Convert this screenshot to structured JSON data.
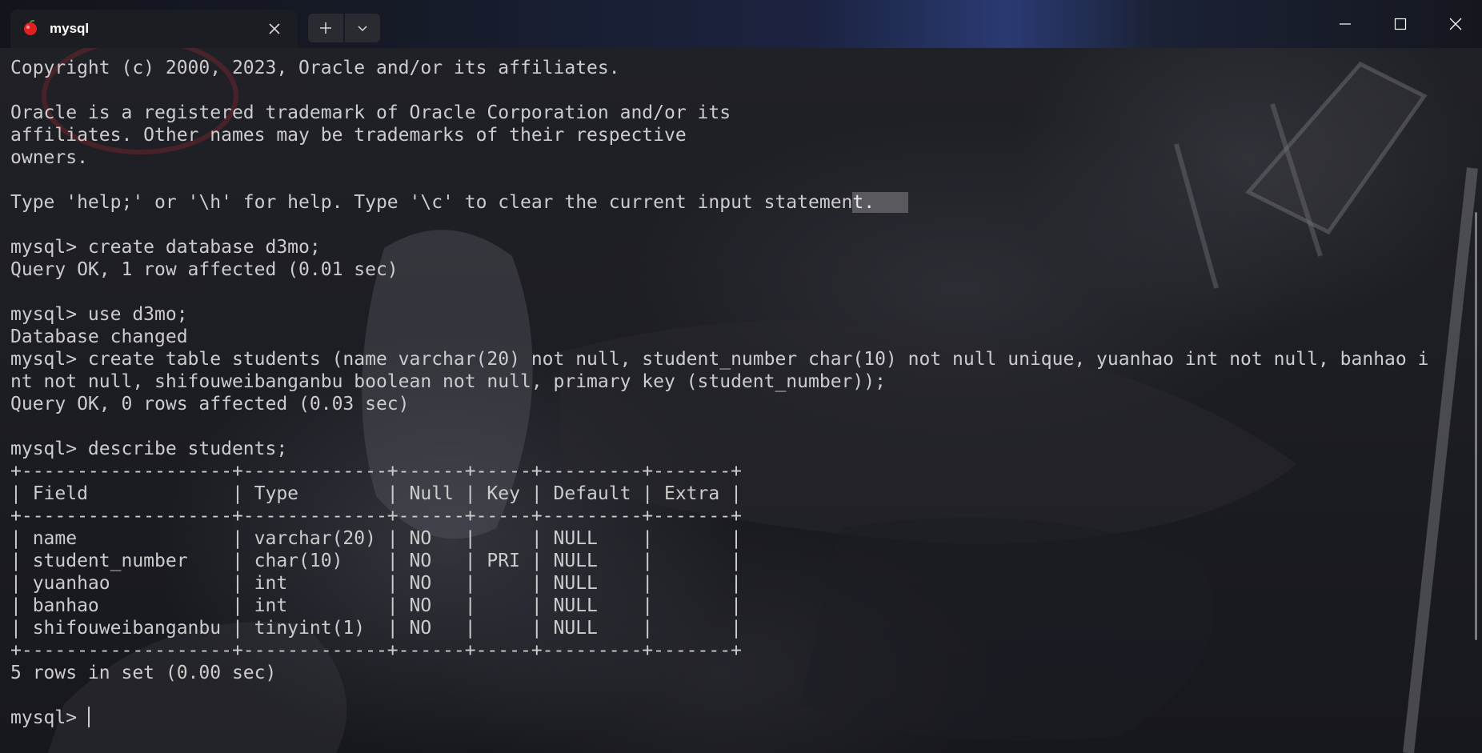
{
  "window": {
    "tab_title": "mysql",
    "tab_icon": "mysql-app-icon",
    "accent_color": "#e02020"
  },
  "terminal": {
    "lines": [
      "Copyright (c) 2000, 2023, Oracle and/or its affiliates.",
      "",
      "Oracle is a registered trademark of Oracle Corporation and/or its",
      "affiliates. Other names may be trademarks of their respective",
      "owners.",
      "",
      "Type 'help;' or '\\h' for help. Type '\\c' to clear the current input statemen",
      "",
      "mysql> create database d3mo;",
      "Query OK, 1 row affected (0.01 sec)",
      "",
      "mysql> use d3mo;",
      "Database changed",
      "mysql> create table students (name varchar(20) not null, student_number char(10) not null unique, yuanhao int not null, banhao i",
      "nt not null, shifouweibanganbu boolean not null, primary key (student_number));",
      "Query OK, 0 rows affected (0.03 sec)",
      "",
      "mysql> describe students;",
      "+-------------------+-------------+------+-----+---------+-------+",
      "| Field             | Type        | Null | Key | Default | Extra |",
      "+-------------------+-------------+------+-----+---------+-------+",
      "| name              | varchar(20) | NO   |     | NULL    |       |",
      "| student_number    | char(10)    | NO   | PRI | NULL    |       |",
      "| yuanhao           | int         | NO   |     | NULL    |       |",
      "| banhao            | int         | NO   |     | NULL    |       |",
      "| shifouweibanganbu | tinyint(1)  | NO   |     | NULL    |       |",
      "+-------------------+-------------+------+-----+---------+-------+",
      "5 rows in set (0.00 sec)",
      "",
      "mysql> "
    ],
    "selected_text": "t.   ",
    "selection_line_index": 6,
    "prompt_line_index": 29,
    "text_color": "#cccccc",
    "selection_color": "#5a5a5e"
  }
}
